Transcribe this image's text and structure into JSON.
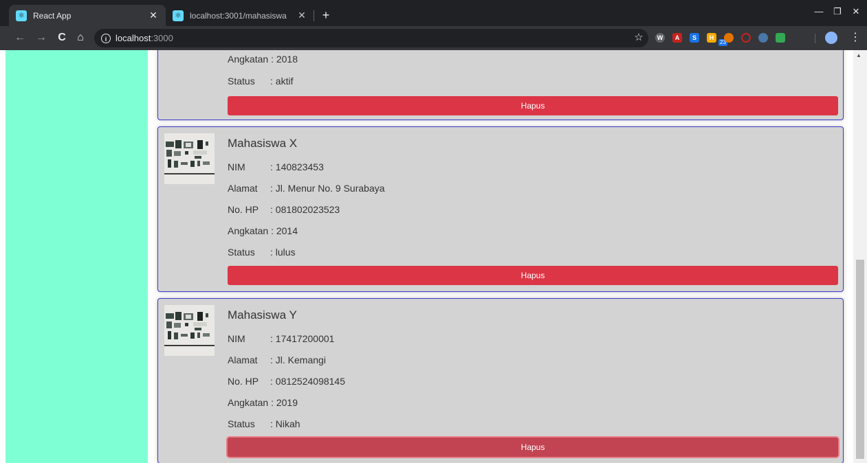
{
  "browser": {
    "tabs": [
      {
        "label": "React App",
        "active": true
      },
      {
        "label": "localhost:3001/mahasiswa",
        "active": false
      }
    ],
    "new_tab": "+",
    "url": {
      "host": "localhost",
      "port": ":3000"
    },
    "extension_badge": "23"
  },
  "students": [
    {
      "name": "",
      "fields": [
        {
          "label": "Angkatan",
          "value": ": 2018"
        },
        {
          "label": "Status",
          "value": ": aktif"
        }
      ],
      "delete_label": "Hapus"
    },
    {
      "name": "Mahasiswa X",
      "fields": [
        {
          "label": "NIM",
          "value": ": 140823453"
        },
        {
          "label": "Alamat",
          "value": ": Jl. Menur No. 9 Surabaya"
        },
        {
          "label": "No. HP",
          "value": ": 081802023523"
        },
        {
          "label": "Angkatan",
          "value": ": 2014"
        },
        {
          "label": "Status",
          "value": ": lulus"
        }
      ],
      "delete_label": "Hapus"
    },
    {
      "name": "Mahasiswa Y",
      "fields": [
        {
          "label": "NIM",
          "value": ": 17417200001"
        },
        {
          "label": "Alamat",
          "value": ": Jl. Kemangi"
        },
        {
          "label": "No. HP",
          "value": ": 0812524098145"
        },
        {
          "label": "Angkatan",
          "value": ": 2019"
        },
        {
          "label": "Status",
          "value": ": Nikah"
        }
      ],
      "delete_label": "Hapus"
    }
  ],
  "colors": {
    "sidebar": "#7fffd4",
    "card_bg": "#d3d3d3",
    "card_border": "#3a3acb",
    "danger": "#dc3545"
  }
}
